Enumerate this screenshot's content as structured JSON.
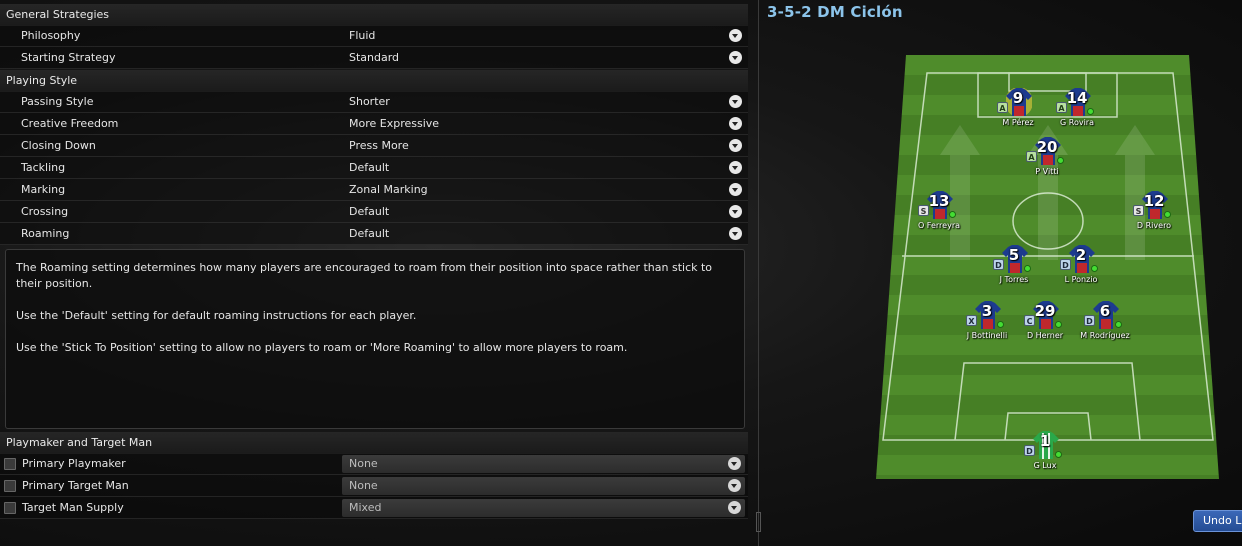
{
  "general": {
    "header": "General Strategies",
    "rows": [
      {
        "label": "Philosophy",
        "value": "Fluid"
      },
      {
        "label": "Starting Strategy",
        "value": "Standard"
      }
    ]
  },
  "playing_style": {
    "header": "Playing Style",
    "rows": [
      {
        "label": "Passing Style",
        "value": "Shorter"
      },
      {
        "label": "Creative Freedom",
        "value": "More Expressive"
      },
      {
        "label": "Closing Down",
        "value": "Press More"
      },
      {
        "label": "Tackling",
        "value": "Default"
      },
      {
        "label": "Marking",
        "value": "Zonal Marking"
      },
      {
        "label": "Crossing",
        "value": "Default"
      },
      {
        "label": "Roaming",
        "value": "Default"
      }
    ]
  },
  "description": {
    "p1": "The Roaming setting determines how many players are encouraged to roam from their position into space rather than stick to their position.",
    "p2": "Use the 'Default' setting for default roaming instructions for each player.",
    "p3": "Use the 'Stick To Position' setting to allow no players to roam or 'More Roaming' to allow more players to roam."
  },
  "playmaker": {
    "header": "Playmaker and Target Man",
    "rows": [
      {
        "label": "Primary Playmaker",
        "value": "None",
        "checked": false
      },
      {
        "label": "Primary Target Man",
        "value": "None",
        "checked": false
      },
      {
        "label": "Target Man Supply",
        "value": "Mixed",
        "checked": false
      }
    ]
  },
  "tactic": {
    "title": "3-5-2 DM Ciclón",
    "players": [
      {
        "number": "9",
        "name": "M Pérez",
        "role": "A",
        "highlight": true
      },
      {
        "number": "14",
        "name": "G Rovira",
        "role": "A"
      },
      {
        "number": "20",
        "name": "P Vitti",
        "role": "A"
      },
      {
        "number": "13",
        "name": "O Ferreyra",
        "role": "S"
      },
      {
        "number": "12",
        "name": "D Rivero",
        "role": "S"
      },
      {
        "number": "5",
        "name": "J Torres",
        "role": "D"
      },
      {
        "number": "2",
        "name": "L Ponzio",
        "role": "D"
      },
      {
        "number": "3",
        "name": "J Bottinelli",
        "role": "X"
      },
      {
        "number": "29",
        "name": "D Herner",
        "role": "C"
      },
      {
        "number": "6",
        "name": "M Rodríguez",
        "role": "D"
      },
      {
        "number": "1",
        "name": "G Lux",
        "role": "D",
        "goalkeeper": true
      }
    ]
  },
  "undo": {
    "label": "Undo L"
  },
  "colors": {
    "accent": "#8cc4ea",
    "pitch": "#4d8a2a",
    "shirt_blue": "#1d3b8f",
    "shirt_red": "#c0282c"
  }
}
